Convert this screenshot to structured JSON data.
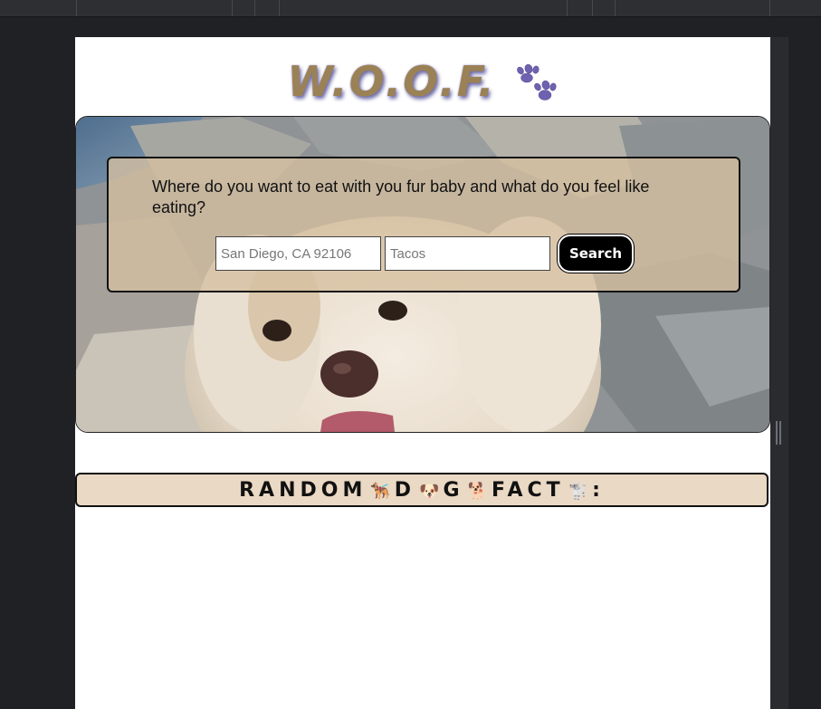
{
  "header": {
    "logo_text": "W.O.O.F.",
    "logo_icon": "paw-prints-icon",
    "logo_color": "#9a8156"
  },
  "search": {
    "prompt": "Where do you want to eat with you fur baby and what do you feel like eating?",
    "location_placeholder": "San Diego, CA 92106",
    "food_placeholder": "Tacos",
    "button_label": "Search"
  },
  "fact": {
    "title_text": "RANDOM🐕‍🦺D🐶G🐕FACT🐩:",
    "title_parts": [
      "RANDOM",
      "🐕‍🦺",
      "D",
      "🐶",
      "G",
      "🐕",
      "FACT",
      "🐩",
      ":"
    ]
  },
  "colors": {
    "fact_bar_bg": "#ead9c4",
    "search_box_bg": "#d6c0a0",
    "button_bg": "#000000"
  }
}
